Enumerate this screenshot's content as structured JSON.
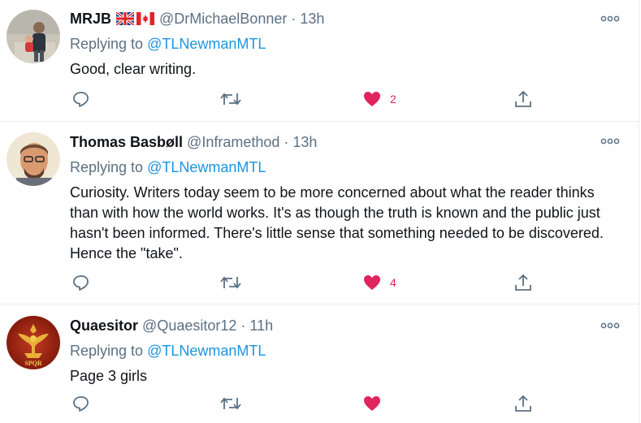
{
  "tweets": [
    {
      "name": "MRJB",
      "flags": [
        "uk-flag-icon",
        "canada-flag-icon"
      ],
      "handle": "@DrMichaelBonner",
      "time": "13h",
      "replying_prefix": "Replying to ",
      "replying_to": "@TLNewmanMTL",
      "text": "Good, clear writing.",
      "like_count": "2",
      "liked": true
    },
    {
      "name": "Thomas Basbøll",
      "handle": "@Inframethod",
      "time": "13h",
      "replying_prefix": "Replying to ",
      "replying_to": "@TLNewmanMTL",
      "text": "Curiosity. Writers today seem to be more concerned about what the reader thinks than with how the world works. It's as though the truth is known and the public just hasn't been informed. There's little sense that something needed to be discovered. Hence the \"take\".",
      "like_count": "4",
      "liked": true
    },
    {
      "name": "Quaesitor",
      "handle": "@Quaesitor12",
      "time": "11h",
      "replying_prefix": "Replying to ",
      "replying_to": "@TLNewmanMTL",
      "text": "Page 3 girls",
      "like_count": "",
      "liked": true
    }
  ],
  "separator": " · ",
  "avatar_text": {
    "quaesitor_emblem": "SPQR"
  },
  "icons": [
    "more-icon",
    "reply-icon",
    "retweet-icon",
    "heart-icon",
    "share-icon"
  ],
  "colors": {
    "like": "#e0245e",
    "mention": "#1b95e0",
    "secondary_text": "#5b7083",
    "icon": "#5b7083",
    "divider": "#e6ecf0"
  }
}
